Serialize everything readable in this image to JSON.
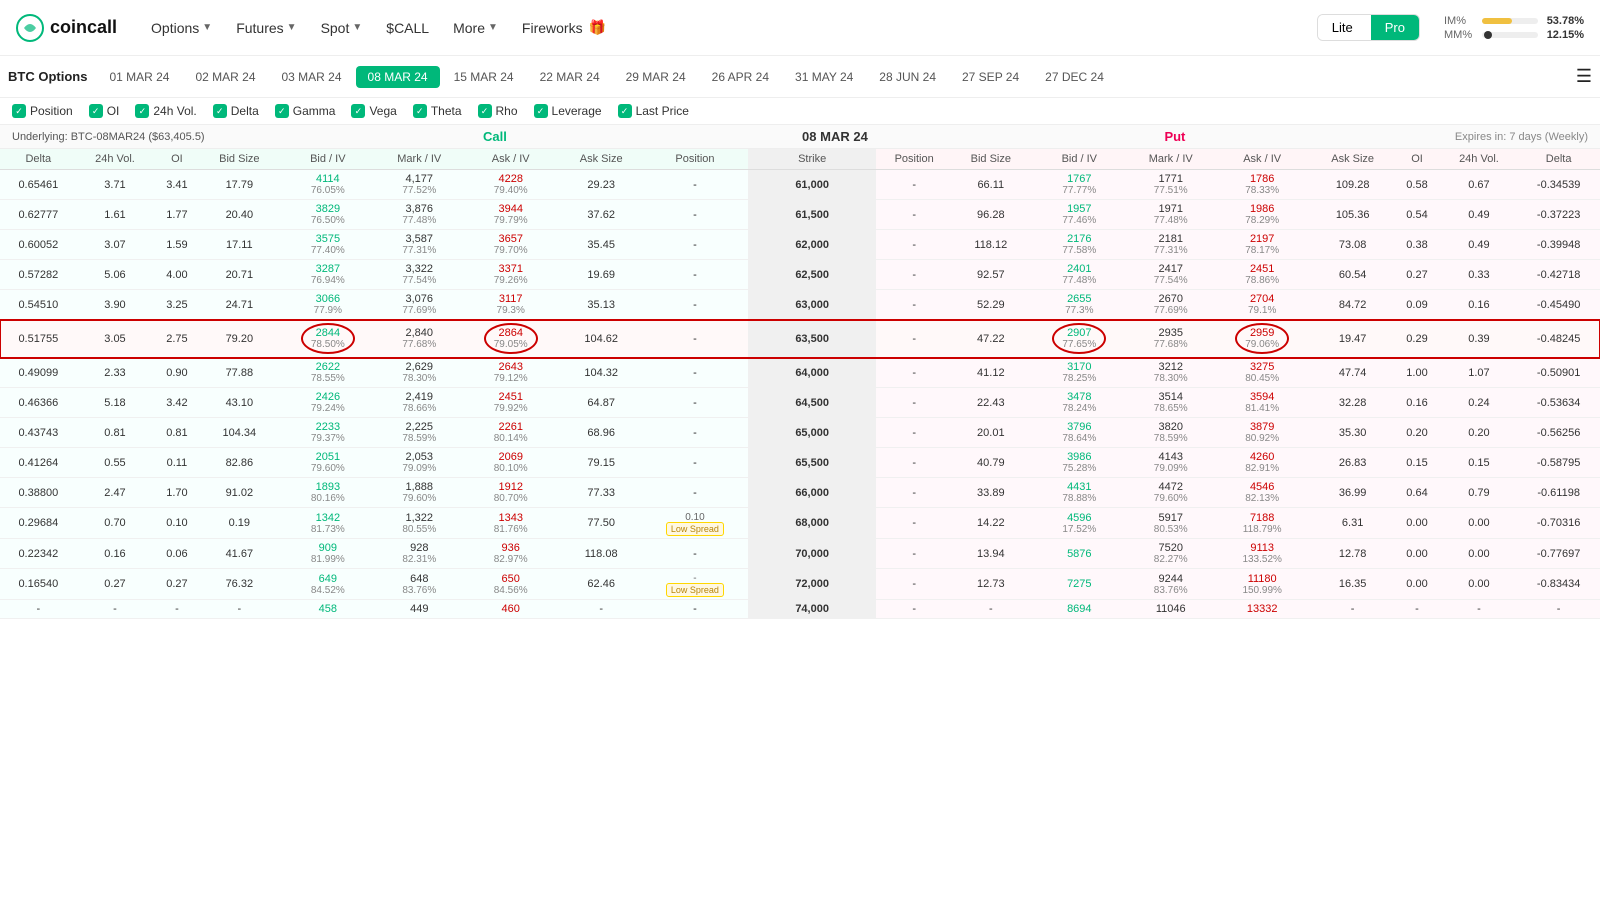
{
  "header": {
    "logo": "coincall",
    "nav": [
      {
        "label": "Options",
        "has_arrow": true
      },
      {
        "label": "Futures",
        "has_arrow": true
      },
      {
        "label": "Spot",
        "has_arrow": true
      },
      {
        "label": "$CALL",
        "has_arrow": false
      },
      {
        "label": "More",
        "has_arrow": true
      },
      {
        "label": "Fireworks",
        "has_arrow": false
      }
    ],
    "modes": [
      "Lite",
      "Pro"
    ],
    "active_mode": "Pro",
    "im_pct": "53.78%",
    "mm_pct": "12.15%",
    "im_bar_width": "54%",
    "mm_bar_width": "12%"
  },
  "date_tabs": [
    "BTC Options",
    "01 MAR 24",
    "02 MAR 24",
    "03 MAR 24",
    "08 MAR 24",
    "15 MAR 24",
    "22 MAR 24",
    "29 MAR 24",
    "26 APR 24",
    "31 MAY 24",
    "28 JUN 24",
    "27 SEP 24",
    "27 DEC 24"
  ],
  "active_date": "08 MAR 24",
  "col_toggles": [
    "Position",
    "OI",
    "24h Vol.",
    "Delta",
    "Gamma",
    "Vega",
    "Theta",
    "Rho",
    "Leverage",
    "Last Price"
  ],
  "underlying": "BTC-08MAR24 ($63,405.5)",
  "call_label": "Call",
  "put_label": "Put",
  "center_date": "08 MAR 24",
  "expires": "Expires in: 7 days (Weekly)",
  "table_headers_call": [
    "Delta",
    "24h Vol.",
    "OI",
    "Bid Size",
    "Bid / IV",
    "Mark / IV",
    "Ask / IV",
    "Ask Size",
    "Position"
  ],
  "table_headers_strike": [
    "Strike"
  ],
  "table_headers_put": [
    "Position",
    "Bid Size",
    "Bid / IV",
    "Mark / IV",
    "Ask / IV",
    "Ask Size",
    "OI",
    "24h Vol.",
    "Delta"
  ],
  "rows": [
    {
      "strike": 61000,
      "call": {
        "delta": "0.65461",
        "vol24": "3.71",
        "oi": "3.41",
        "bid_size": "17.79",
        "bid": "4114",
        "bid_iv": "76.05%",
        "mark": "4,177",
        "mark_iv": "77.52%",
        "ask": "4228",
        "ask_iv": "79.40%",
        "ask_size": "29.23",
        "position": "-"
      },
      "put": {
        "position": "-",
        "bid_size": "66.11",
        "bid": "1767",
        "bid_iv": "77.77%",
        "mark": "1771",
        "mark_iv": "77.51%",
        "ask": "1786",
        "ask_iv": "78.33%",
        "ask_size": "109.28",
        "oi": "0.58",
        "vol24": "0.67",
        "delta": "-0.34539"
      }
    },
    {
      "strike": 61500,
      "call": {
        "delta": "0.62777",
        "vol24": "1.61",
        "oi": "1.77",
        "bid_size": "20.40",
        "bid": "3829",
        "bid_iv": "76.50%",
        "mark": "3,876",
        "mark_iv": "77.48%",
        "ask": "3944",
        "ask_iv": "79.79%",
        "ask_size": "37.62",
        "position": "-"
      },
      "put": {
        "position": "-",
        "bid_size": "96.28",
        "bid": "1957",
        "bid_iv": "77.46%",
        "mark": "1971",
        "mark_iv": "77.48%",
        "ask": "1986",
        "ask_iv": "78.29%",
        "ask_size": "105.36",
        "oi": "0.54",
        "vol24": "0.49",
        "delta": "-0.37223"
      }
    },
    {
      "strike": 62000,
      "call": {
        "delta": "0.60052",
        "vol24": "3.07",
        "oi": "1.59",
        "bid_size": "17.11",
        "bid": "3575",
        "bid_iv": "77.40%",
        "mark": "3,587",
        "mark_iv": "77.31%",
        "ask": "3657",
        "ask_iv": "79.70%",
        "ask_size": "35.45",
        "position": "-"
      },
      "put": {
        "position": "-",
        "bid_size": "118.12",
        "bid": "2176",
        "bid_iv": "77.58%",
        "mark": "2181",
        "mark_iv": "77.31%",
        "ask": "2197",
        "ask_iv": "78.17%",
        "ask_size": "73.08",
        "oi": "0.38",
        "vol24": "0.49",
        "delta": "-0.39948"
      }
    },
    {
      "strike": 62500,
      "call": {
        "delta": "0.57282",
        "vol24": "5.06",
        "oi": "4.00",
        "bid_size": "20.71",
        "bid": "3287",
        "bid_iv": "76.94%",
        "mark": "3,322",
        "mark_iv": "77.54%",
        "ask": "3371",
        "ask_iv": "79.26%",
        "ask_size": "19.69",
        "position": "-"
      },
      "put": {
        "position": "-",
        "bid_size": "92.57",
        "bid": "2401",
        "bid_iv": "77.48%",
        "mark": "2417",
        "mark_iv": "77.54%",
        "ask": "2451",
        "ask_iv": "78.86%",
        "ask_size": "60.54",
        "oi": "0.27",
        "vol24": "0.33",
        "delta": "-0.42718"
      }
    },
    {
      "strike": 63000,
      "call": {
        "delta": "0.54510",
        "vol24": "3.90",
        "oi": "3.25",
        "bid_size": "24.71",
        "bid": "3066",
        "bid_iv": "77.9%",
        "mark": "3,076",
        "mark_iv": "77.69%",
        "ask": "3117",
        "ask_iv": "79.3%",
        "ask_size": "35.13",
        "position": "-"
      },
      "put": {
        "position": "-",
        "bid_size": "52.29",
        "bid": "2655",
        "bid_iv": "77.3%",
        "mark": "2670",
        "mark_iv": "77.69%",
        "ask": "2704",
        "ask_iv": "79.1%",
        "ask_size": "84.72",
        "oi": "0.09",
        "vol24": "0.16",
        "delta": "-0.45490"
      }
    },
    {
      "strike": 63500,
      "call": {
        "delta": "0.51755",
        "vol24": "3.05",
        "oi": "2.75",
        "bid_size": "79.20",
        "bid": "2844",
        "bid_iv": "78.50%",
        "mark": "2,840",
        "mark_iv": "77.68%",
        "ask": "2864",
        "ask_iv": "79.05%",
        "ask_size": "104.62",
        "position": "-"
      },
      "put": {
        "position": "-",
        "bid_size": "47.22",
        "bid": "2907",
        "bid_iv": "77.65%",
        "mark": "2935",
        "mark_iv": "77.68%",
        "ask": "2959",
        "ask_iv": "79.06%",
        "ask_size": "19.47",
        "oi": "0.29",
        "vol24": "0.39",
        "delta": "-0.48245"
      },
      "highlighted": true
    },
    {
      "strike": 64000,
      "call": {
        "delta": "0.49099",
        "vol24": "2.33",
        "oi": "0.90",
        "bid_size": "77.88",
        "bid": "2622",
        "bid_iv": "78.55%",
        "mark": "2,629",
        "mark_iv": "78.30%",
        "ask": "2643",
        "ask_iv": "79.12%",
        "ask_size": "104.32",
        "position": "-"
      },
      "put": {
        "position": "-",
        "bid_size": "41.12",
        "bid": "3170",
        "bid_iv": "78.25%",
        "mark": "3212",
        "mark_iv": "78.30%",
        "ask": "3275",
        "ask_iv": "80.45%",
        "ask_size": "47.74",
        "oi": "1.00",
        "vol24": "1.07",
        "delta": "-0.50901"
      }
    },
    {
      "strike": 64500,
      "call": {
        "delta": "0.46366",
        "vol24": "5.18",
        "oi": "3.42",
        "bid_size": "43.10",
        "bid": "2426",
        "bid_iv": "79.24%",
        "mark": "2,419",
        "mark_iv": "78.66%",
        "ask": "2451",
        "ask_iv": "79.92%",
        "ask_size": "64.87",
        "position": "-"
      },
      "put": {
        "position": "-",
        "bid_size": "22.43",
        "bid": "3478",
        "bid_iv": "78.24%",
        "mark": "3514",
        "mark_iv": "78.65%",
        "ask": "3594",
        "ask_iv": "81.41%",
        "ask_size": "32.28",
        "oi": "0.16",
        "vol24": "0.24",
        "delta": "-0.53634"
      }
    },
    {
      "strike": 65000,
      "call": {
        "delta": "0.43743",
        "vol24": "0.81",
        "oi": "0.81",
        "bid_size": "104.34",
        "bid": "2233",
        "bid_iv": "79.37%",
        "mark": "2,225",
        "mark_iv": "78.59%",
        "ask": "2261",
        "ask_iv": "80.14%",
        "ask_size": "68.96",
        "position": "-"
      },
      "put": {
        "position": "-",
        "bid_size": "20.01",
        "bid": "3796",
        "bid_iv": "78.64%",
        "mark": "3820",
        "mark_iv": "78.59%",
        "ask": "3879",
        "ask_iv": "80.92%",
        "ask_size": "35.30",
        "oi": "0.20",
        "vol24": "0.20",
        "delta": "-0.56256"
      }
    },
    {
      "strike": 65500,
      "call": {
        "delta": "0.41264",
        "vol24": "0.55",
        "oi": "0.11",
        "bid_size": "82.86",
        "bid": "2051",
        "bid_iv": "79.60%",
        "mark": "2,053",
        "mark_iv": "79.09%",
        "ask": "2069",
        "ask_iv": "80.10%",
        "ask_size": "79.15",
        "position": "-"
      },
      "put": {
        "position": "-",
        "bid_size": "40.79",
        "bid": "3986",
        "bid_iv": "75.28%",
        "mark": "4143",
        "mark_iv": "79.09%",
        "ask": "4260",
        "ask_iv": "82.91%",
        "ask_size": "26.83",
        "oi": "0.15",
        "vol24": "0.15",
        "delta": "-0.58795"
      }
    },
    {
      "strike": 66000,
      "call": {
        "delta": "0.38800",
        "vol24": "2.47",
        "oi": "1.70",
        "bid_size": "91.02",
        "bid": "1893",
        "bid_iv": "80.16%",
        "mark": "1,888",
        "mark_iv": "79.60%",
        "ask": "1912",
        "ask_iv": "80.70%",
        "ask_size": "77.33",
        "position": "-"
      },
      "put": {
        "position": "-",
        "bid_size": "33.89",
        "bid": "4431",
        "bid_iv": "78.88%",
        "mark": "4472",
        "mark_iv": "79.60%",
        "ask": "4546",
        "ask_iv": "82.13%",
        "ask_size": "36.99",
        "oi": "0.64",
        "vol24": "0.79",
        "delta": "-0.61198"
      }
    },
    {
      "strike": 68000,
      "call": {
        "delta": "0.29684",
        "vol24": "0.70",
        "oi": "0.10",
        "bid_size": "0.19",
        "bid": "1342",
        "bid_iv": "81.73%",
        "mark": "1,322",
        "mark_iv": "80.55%",
        "ask": "1343",
        "ask_iv": "81.76%",
        "ask_size": "77.50",
        "position": "0.10"
      },
      "put": {
        "position": "-",
        "bid_size": "14.22",
        "bid": "4596",
        "bid_iv": "17.52%",
        "mark": "5917",
        "mark_iv": "80.53%",
        "ask": "7188",
        "ask_iv": "118.79%",
        "ask_size": "6.31",
        "oi": "0.00",
        "vol24": "0.00",
        "delta": "-0.70316"
      },
      "low_spread_call": true
    },
    {
      "strike": 70000,
      "call": {
        "delta": "0.22342",
        "vol24": "0.16",
        "oi": "0.06",
        "bid_size": "41.67",
        "bid": "909",
        "bid_iv": "81.99%",
        "mark": "928",
        "mark_iv": "82.31%",
        "ask": "936",
        "ask_iv": "82.97%",
        "ask_size": "118.08",
        "position": "-"
      },
      "put": {
        "position": "-",
        "bid_size": "13.94",
        "bid": "5876",
        "bid_iv": "",
        "mark": "7520",
        "mark_iv": "82.27%",
        "ask": "9113",
        "ask_iv": "133.52%",
        "ask_size": "12.78",
        "oi": "0.00",
        "vol24": "0.00",
        "delta": "-0.77697"
      }
    },
    {
      "strike": 72000,
      "call": {
        "delta": "0.16540",
        "vol24": "0.27",
        "oi": "0.27",
        "bid_size": "76.32",
        "bid": "649",
        "bid_iv": "84.52%",
        "mark": "648",
        "mark_iv": "83.76%",
        "ask": "650",
        "ask_iv": "84.56%",
        "ask_size": "62.46",
        "position": "-"
      },
      "put": {
        "position": "-",
        "bid_size": "12.73",
        "bid": "7275",
        "bid_iv": "",
        "mark": "9244",
        "mark_iv": "83.76%",
        "ask": "11180",
        "ask_iv": "150.99%",
        "ask_size": "16.35",
        "oi": "0.00",
        "vol24": "0.00",
        "delta": "-0.83434"
      },
      "low_spread_call": true
    },
    {
      "strike": 74000,
      "call": {
        "delta": "",
        "vol24": "",
        "oi": "",
        "bid_size": "",
        "bid": "458",
        "bid_iv": "",
        "mark": "449",
        "mark_iv": "",
        "ask": "460",
        "ask_iv": "",
        "ask_size": "",
        "position": "-"
      },
      "put": {
        "position": "-",
        "bid_size": "",
        "bid": "8694",
        "bid_iv": "",
        "mark": "11046",
        "mark_iv": "",
        "ask": "13332",
        "ask_iv": "",
        "ask_size": "",
        "oi": "",
        "vol24": "",
        "delta": ""
      }
    }
  ]
}
